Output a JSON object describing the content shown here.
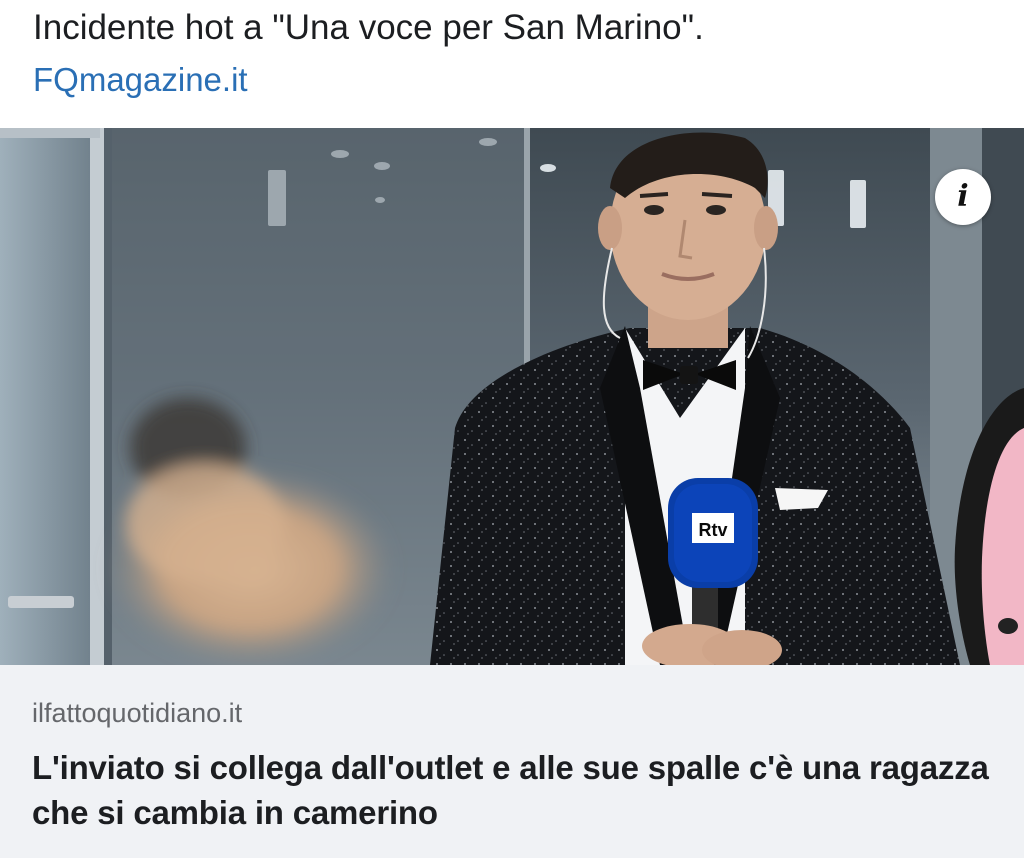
{
  "post": {
    "headline": "Incidente hot a \"Una voce per San Marino\".",
    "source_link": "FQmagazine.it"
  },
  "card": {
    "domain": "ilfattoquotidiano.it",
    "title": "L'inviato si collega dall'outlet e alle sue spalle c'è una ragazza che si cambia in camerino",
    "info_icon": "info-icon",
    "microphone_label": "Rtv"
  },
  "colors": {
    "link": "#2a6fb5",
    "text": "#1c1e21",
    "muted": "#65676b",
    "footer_bg": "#f0f2f5"
  }
}
